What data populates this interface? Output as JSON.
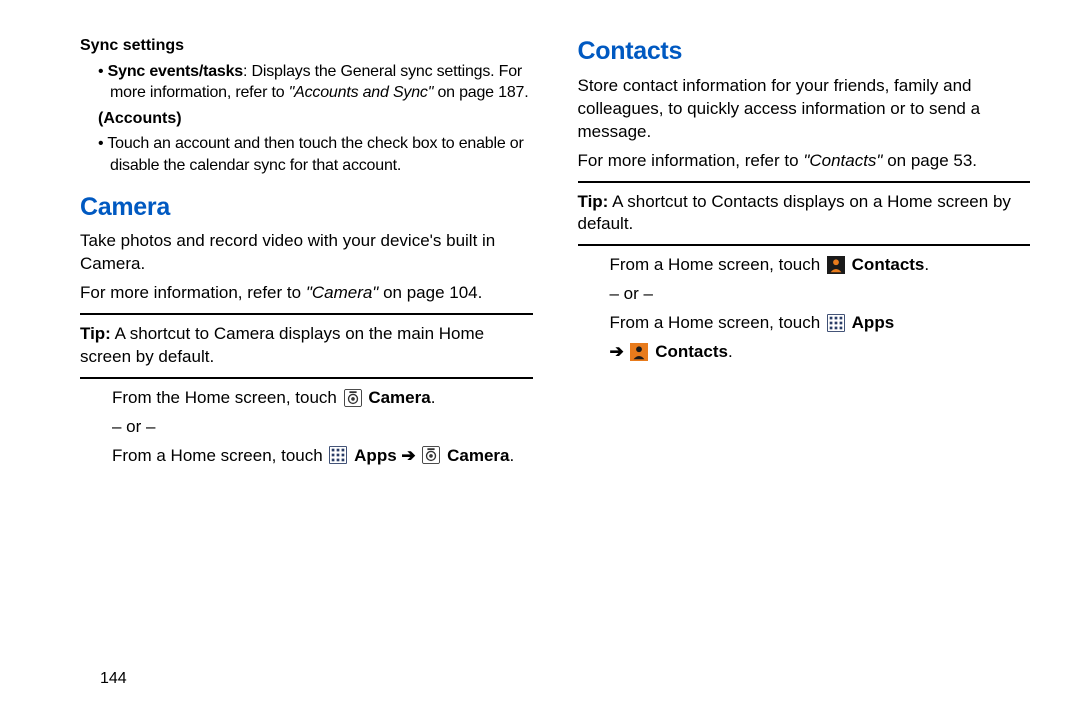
{
  "left": {
    "sync_heading": "Sync settings",
    "sync_bullet_bold": "Sync events/tasks",
    "sync_bullet_rest_a": ": Displays the General sync settings. For more information, refer to ",
    "sync_bullet_italic": "\"Accounts and Sync\"",
    "sync_bullet_rest_b": " on page 187.",
    "accounts_heading": "(Accounts)",
    "accounts_bullet": "Touch an account and then touch the check box to enable or disable the calendar sync for that account.",
    "camera_h1": "Camera",
    "camera_p1": "Take photos and record video with your device's built in Camera.",
    "camera_ref_a": "For more information, refer to ",
    "camera_ref_italic": "\"Camera\"",
    "camera_ref_b": " on page 104.",
    "camera_tip_label": "Tip:",
    "camera_tip_body": " A shortcut to Camera displays on the main Home screen by default.",
    "camera_steps_a": "From the Home screen, touch ",
    "camera_word": "Camera",
    "or_text": "– or –",
    "camera_steps_b": "From a Home screen, touch ",
    "apps_word": "Apps"
  },
  "right": {
    "contacts_h1": "Contacts",
    "contacts_p1": "Store contact information for your friends, family and colleagues, to quickly access information or to send a message.",
    "contacts_ref_a": "For more information, refer to ",
    "contacts_ref_italic": "\"Contacts\"",
    "contacts_ref_b": " on page 53.",
    "contacts_tip_label": "Tip:",
    "contacts_tip_body": " A shortcut to Contacts displays on a Home screen by default.",
    "contacts_steps_a": "From a Home screen, touch ",
    "contacts_word": "Contacts",
    "or_text": "– or –",
    "contacts_steps_b": "From a Home screen, touch ",
    "apps_word": "Apps"
  },
  "arrow_glyph": "➔",
  "page_number": "144"
}
